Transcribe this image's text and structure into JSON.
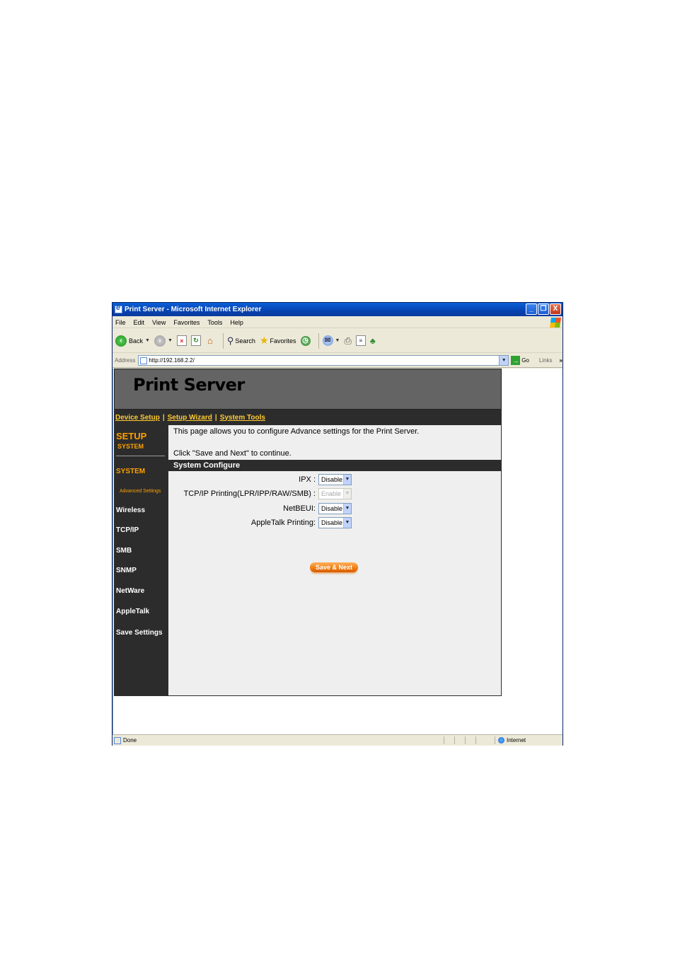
{
  "window": {
    "title": "Print Server - Microsoft Internet Explorer",
    "minimize": "_",
    "restore": "❐",
    "close": "X"
  },
  "menu": [
    "File",
    "Edit",
    "View",
    "Favorites",
    "Tools",
    "Help"
  ],
  "toolbar": {
    "back": "Back",
    "search": "Search",
    "favorites": "Favorites"
  },
  "address": {
    "label": "Address",
    "url": "http://192.168.2.2/",
    "go": "Go",
    "links": "Links",
    "links_more": "»"
  },
  "page": {
    "title": "Print Server",
    "nav": [
      "Device Setup",
      "Setup Wizard",
      "System Tools"
    ],
    "nav_sep": "|"
  },
  "sidebar": {
    "setup": "SETUP",
    "setup_sub": "SYSTEM",
    "items": [
      {
        "label": "SYSTEM",
        "active": true
      },
      {
        "label": "Advanced Settings",
        "sub": true
      },
      {
        "label": "Wireless"
      },
      {
        "label": "TCP/IP"
      },
      {
        "label": "SMB"
      },
      {
        "label": "SNMP"
      },
      {
        "label": "NetWare"
      },
      {
        "label": "AppleTalk"
      },
      {
        "label": "Save Settings"
      }
    ]
  },
  "content": {
    "intro": "This page allows you to configure Advance settings for the Print Server.",
    "continue": "Click \"Save and Next\" to continue.",
    "section": "System Configure",
    "fields": [
      {
        "label": "IPX :",
        "value": "Disable",
        "disabled": false
      },
      {
        "label": "TCP/IP Printing(LPR/IPP/RAW/SMB) :",
        "value": "Enable",
        "disabled": true
      },
      {
        "label": "NetBEUI:",
        "value": "Disable",
        "disabled": false
      },
      {
        "label": "AppleTalk Printing:",
        "value": "Disable",
        "disabled": false
      }
    ],
    "save_button": "Save & Next"
  },
  "status": {
    "text": "Done",
    "zone": "Internet"
  },
  "colors": {
    "title_bar": "#0842b0",
    "nav_link": "#ffcc33",
    "sidebar_accent": "#ffa000",
    "dark_panel": "#2c2c2c",
    "header_gray": "#646464",
    "button_orange": "#f07b10"
  }
}
